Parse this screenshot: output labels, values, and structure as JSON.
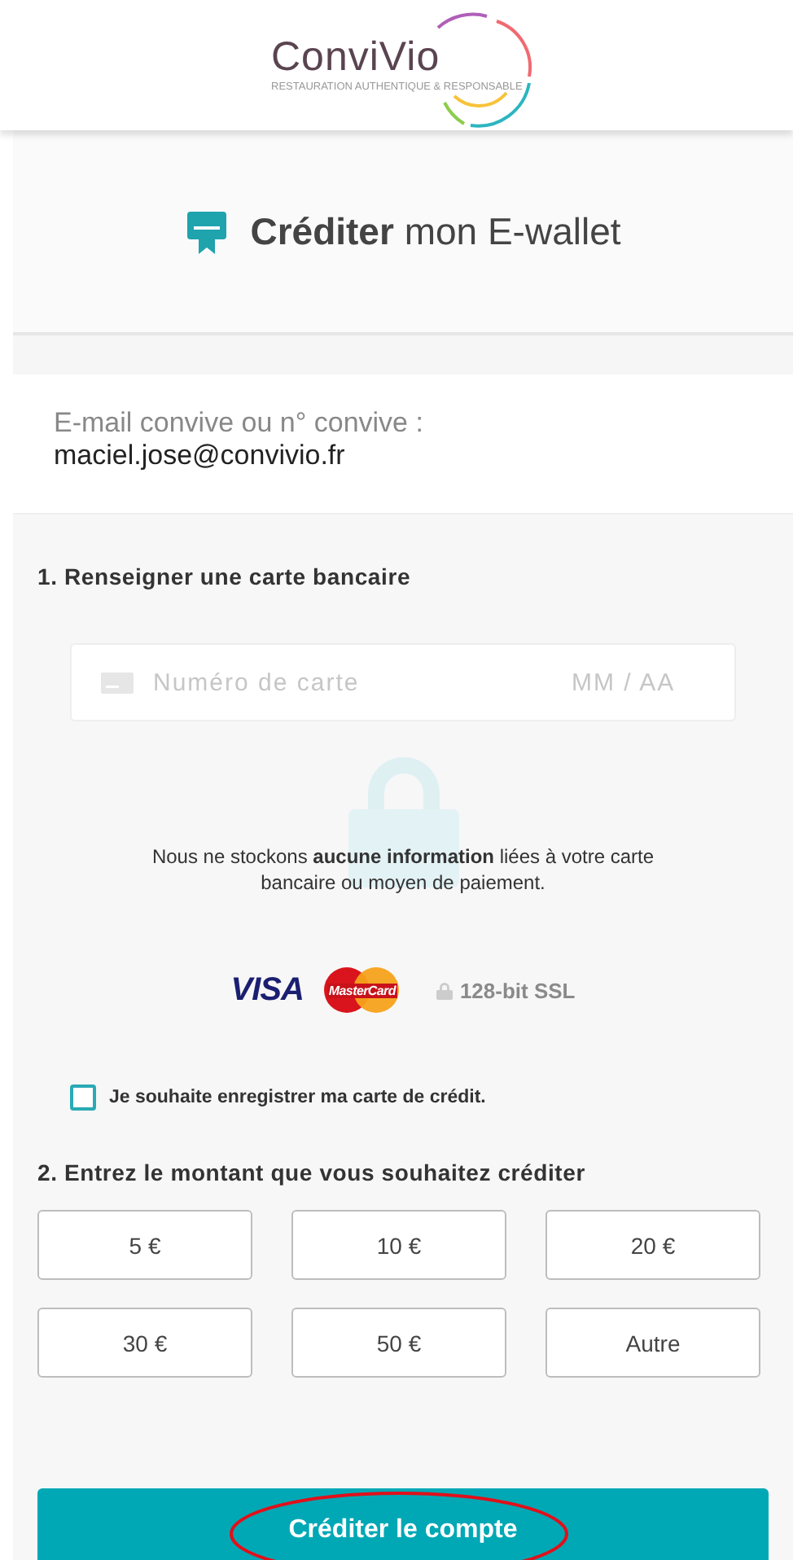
{
  "header": {
    "logo": "ConviVio",
    "tagline": "RESTAURATION AUTHENTIQUE & RESPONSABLE"
  },
  "title": "**Créditer** mon E-wallet",
  "account": {
    "label": "E-mail convive ou n° convive :",
    "value": "maciel.jose@convivio.fr"
  },
  "card_section": {
    "heading": "1. Renseigner une carte bancaire",
    "card_number": {
      "placeholder": "Numéro de carte"
    },
    "expiry": {
      "placeholder": "MM / AA"
    },
    "notice": "Nous ne stockons **aucune information** liées à votre carte bancaire ou moyen de paiement.",
    "brands": [
      "VISA",
      "MasterCard"
    ],
    "ssl": "128-bit SSL",
    "save_card": {
      "label": "Je souhaite enregistrer ma carte de crédit.",
      "checked": false
    }
  },
  "amount_section": {
    "heading": "2. Entrez le montant que vous souhaitez créditer",
    "amounts": [
      {
        "label": "5 €",
        "selected": false
      },
      {
        "label": "10 €",
        "selected": false
      },
      {
        "label": "20 €",
        "selected": false
      },
      {
        "label": "30 €",
        "selected": false
      },
      {
        "label": "50 €",
        "selected": false
      },
      {
        "label": "Autre",
        "selected": false
      }
    ]
  },
  "submit": "Créditer le compte"
}
